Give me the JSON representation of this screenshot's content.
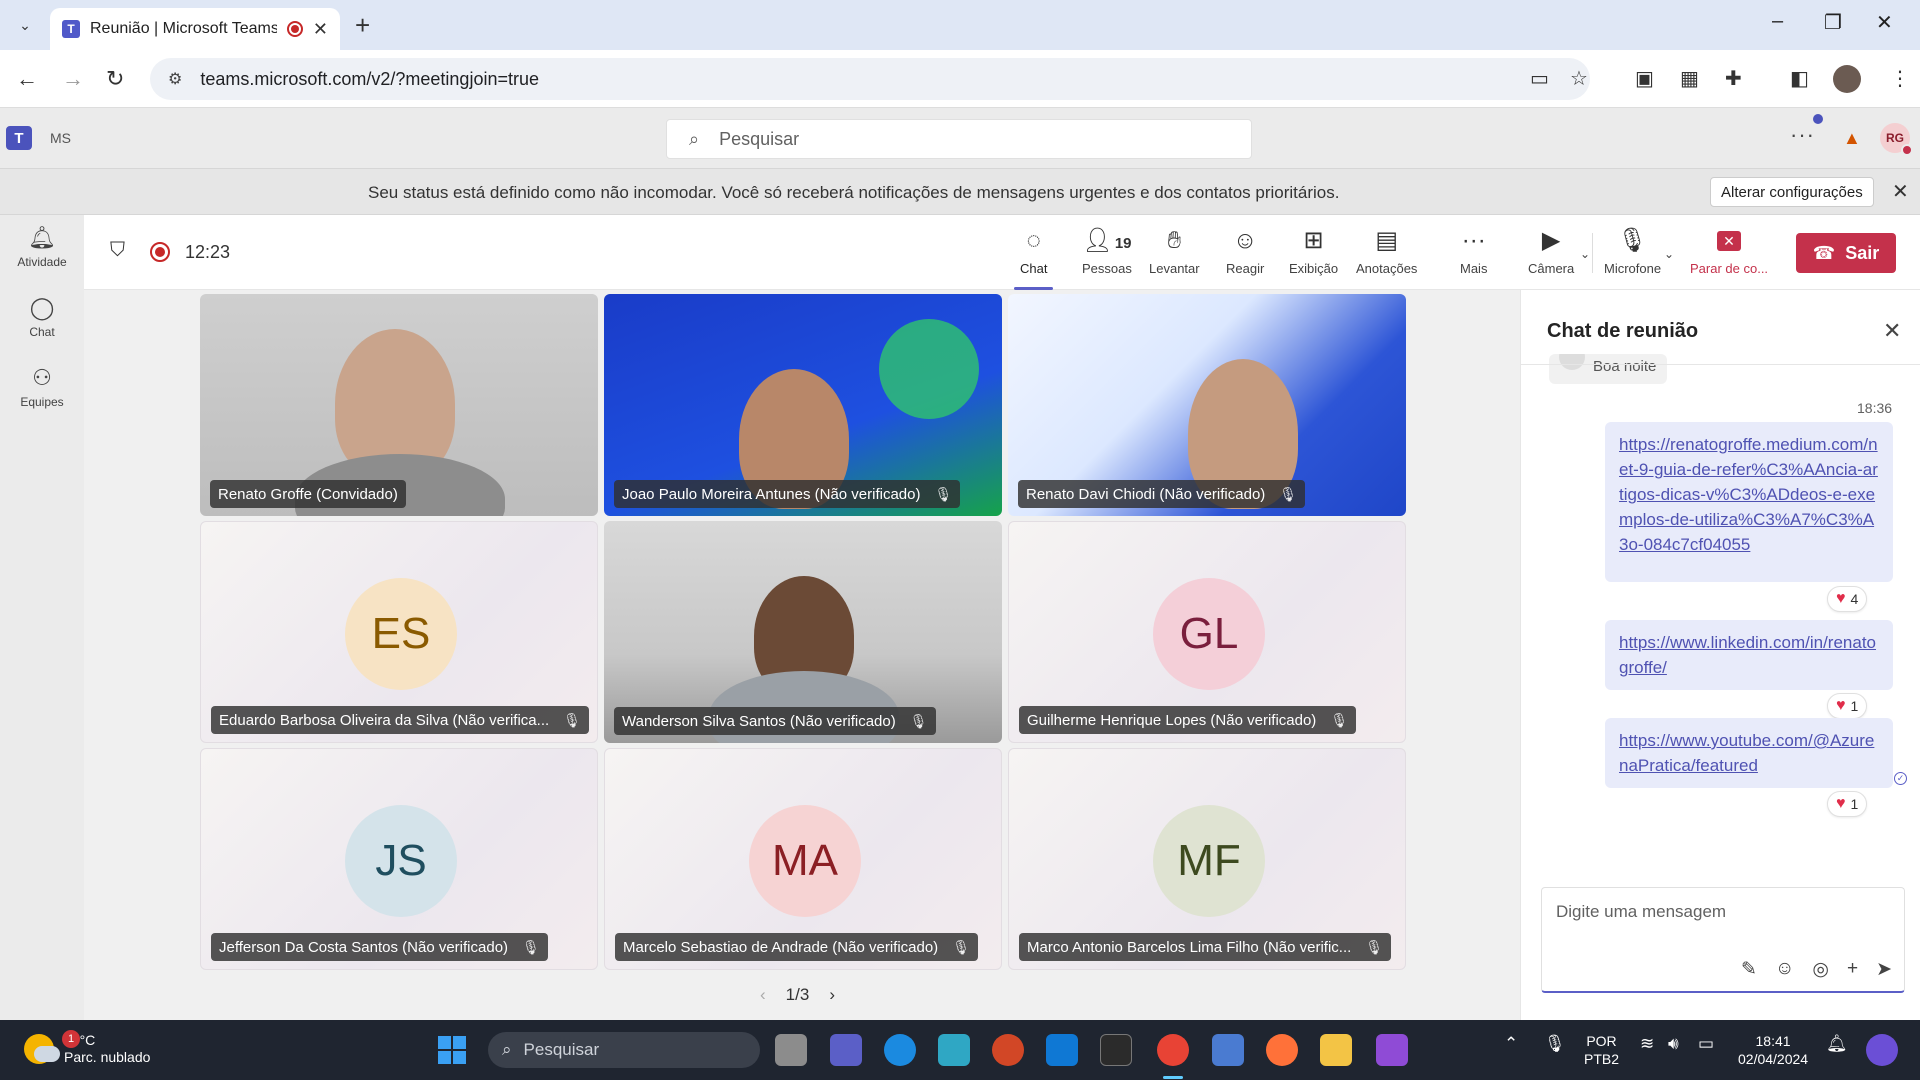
{
  "browser": {
    "tab_title": "Reunião | Microsoft Teams",
    "url": "teams.microsoft.com/v2/?meetingjoin=true"
  },
  "teams": {
    "org_label": "MS",
    "search_placeholder": "Pesquisar",
    "user_initials": "RG"
  },
  "status_banner": {
    "message": "Seu status está definido como não incomodar. Você só receberá notificações de mensagens urgentes e dos contatos prioritários.",
    "button": "Alterar configurações"
  },
  "rail": [
    {
      "label": "Atividade",
      "icon": "bell-icon"
    },
    {
      "label": "Chat",
      "icon": "chat-icon"
    },
    {
      "label": "Equipes",
      "icon": "teams-icon"
    }
  ],
  "meeting": {
    "timer": "12:23",
    "controls": {
      "chat": "Chat",
      "people": "Pessoas",
      "people_count": "19",
      "raise": "Levantar",
      "react": "Reagir",
      "view": "Exibição",
      "notes": "Anotações",
      "more": "Mais",
      "camera": "Câmera",
      "mic": "Microfone",
      "stop": "Parar de co...",
      "leave": "Sair"
    },
    "participants": [
      {
        "name": "Renato Groffe (Convidado)",
        "muted": false,
        "video": true
      },
      {
        "name": "Joao Paulo Moreira Antunes (Não verificado)",
        "muted": true,
        "video": true
      },
      {
        "name": "Renato Davi Chiodi (Não verificado)",
        "muted": true,
        "video": true
      },
      {
        "name": "Eduardo Barbosa Oliveira da Silva (Não verifica...",
        "initials": "ES",
        "muted": true,
        "video": false,
        "color": "#f7e3c4",
        "text_color": "#8a5a00"
      },
      {
        "name": "Wanderson Silva Santos (Não verificado)",
        "muted": true,
        "video": true
      },
      {
        "name": "Guilherme Henrique Lopes (Não verificado)",
        "initials": "GL",
        "muted": true,
        "video": false,
        "color": "#f4cfd8",
        "text_color": "#7a1f3d"
      },
      {
        "name": "Jefferson Da Costa Santos (Não verificado)",
        "initials": "JS",
        "muted": true,
        "video": false,
        "color": "#d4e3ea",
        "text_color": "#1f4e5f"
      },
      {
        "name": "Marcelo Sebastiao de Andrade (Não verificado)",
        "initials": "MA",
        "muted": true,
        "video": false,
        "color": "#f6d3d3",
        "text_color": "#8b1f24"
      },
      {
        "name": "Marco Antonio Barcelos Lima Filho (Não verific...",
        "initials": "MF",
        "muted": true,
        "video": false,
        "color": "#dfe3d2",
        "text_color": "#3d4a1f"
      }
    ],
    "pager": "1/3"
  },
  "chat": {
    "title": "Chat de reunião",
    "clipped_message": "Boa noite",
    "time": "18:36",
    "messages": [
      {
        "text": "https://renatogroffe.medium.com/net-9-guia-de-refer%C3%AAncia-artigos-dicas-v%C3%ADdeos-e-exemplos-de-utiliza%C3%A7%C3%A3o-084c7cf04055",
        "reactions": "4"
      },
      {
        "text": "https://www.linkedin.com/in/renatogroffe/",
        "reactions": "1"
      },
      {
        "text": "https://www.youtube.com/@AzurenaPratica/featured",
        "reactions": "1"
      }
    ],
    "composer_placeholder": "Digite uma mensagem"
  },
  "taskbar": {
    "weather_temp": "27°C",
    "weather_desc": "Parc. nublado",
    "weather_badge": "1",
    "search": "Pesquisar",
    "lang1": "POR",
    "lang2": "PTB2",
    "time": "18:41",
    "date": "02/04/2024"
  }
}
